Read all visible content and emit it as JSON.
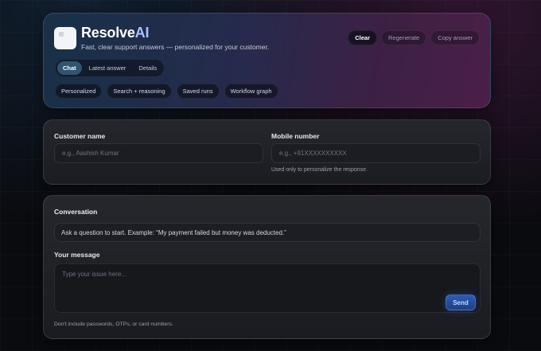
{
  "header": {
    "brand_main": "Resolve",
    "brand_accent": "AI",
    "tagline": "Fast, clear support answers — personalized for your customer.",
    "actions": {
      "clear": "Clear",
      "regenerate": "Regenerate",
      "copy": "Copy answer"
    },
    "tabs": [
      {
        "label": "Chat",
        "active": true
      },
      {
        "label": "Latest answer",
        "active": false
      },
      {
        "label": "Details",
        "active": false
      }
    ],
    "chips": [
      "Personalized",
      "Search + reasoning",
      "Saved runs",
      "Workflow graph"
    ]
  },
  "customer": {
    "name_label": "Customer name",
    "name_placeholder": "e.g., Aashish Kumar",
    "name_value": "",
    "mobile_label": "Mobile number",
    "mobile_placeholder": "e.g., +91XXXXXXXXXX",
    "mobile_value": "",
    "mobile_hint": "Used only to personalize the response."
  },
  "conversation": {
    "title": "Conversation",
    "empty_prompt": "Ask a question to start. Example: “My payment failed but money was deducted.”",
    "message_label": "Your message",
    "message_placeholder": "Type your issue here...",
    "message_value": "",
    "send_label": "Send",
    "footnote": "Don't include passwords, OTPs, or card numbers."
  },
  "colors": {
    "accent_blue": "#2f5cb3",
    "brand_accent": "#a9c4ff",
    "active_tab": "#2f5570",
    "background": "#0a0b0f"
  }
}
